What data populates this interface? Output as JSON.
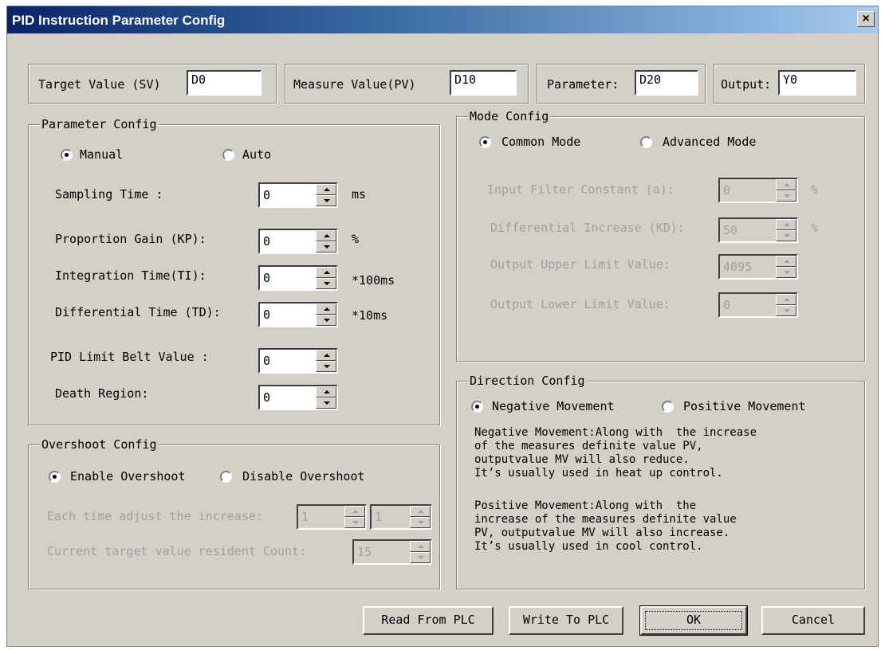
{
  "window": {
    "title": "PID Instruction Parameter Config",
    "close_glyph": "×"
  },
  "top": {
    "target": {
      "label": "Target Value (SV)",
      "value": "D0"
    },
    "measure": {
      "label": "Measure Value(PV)",
      "value": "D10"
    },
    "parameter": {
      "label": "Parameter:",
      "value": "D20"
    },
    "output": {
      "label": "Output:",
      "value": "Y0"
    }
  },
  "param_config": {
    "title": "Parameter Config",
    "manual": "Manual",
    "auto": "Auto",
    "selected": "Manual",
    "rows": [
      {
        "label": "Sampling Time :",
        "value": "0",
        "unit": "ms"
      },
      {
        "label": "Proportion Gain (KP):",
        "value": "0",
        "unit": "%"
      },
      {
        "label": "Integration Time(TI):",
        "value": "0",
        "unit": "*100ms"
      },
      {
        "label": "Differential Time (TD):",
        "value": "0",
        "unit": "*10ms"
      },
      {
        "label": "PID Limit Belt Value :",
        "value": "0",
        "unit": ""
      },
      {
        "label": "Death Region:",
        "value": "0",
        "unit": ""
      }
    ]
  },
  "mode_config": {
    "title": "Mode Config",
    "common": "Common Mode",
    "advanced": "Advanced Mode",
    "selected": "Common Mode",
    "rows": [
      {
        "label": "Input Filter Constant (a):",
        "value": "0",
        "unit": "%"
      },
      {
        "label": "Differential Increase (KD):",
        "value": "50",
        "unit": "%"
      },
      {
        "label": "Output Upper Limit Value:",
        "value": "4095",
        "unit": ""
      },
      {
        "label": "Output Lower Limit Value:",
        "value": "0",
        "unit": ""
      }
    ]
  },
  "overshoot": {
    "title": "Overshoot Config",
    "enable": "Enable Overshoot",
    "disable": "Disable Overshoot",
    "selected": "Enable Overshoot",
    "increase_label": "Each time adjust the increase:",
    "increase_a": "1",
    "increase_b": "1",
    "resident_label": "Current target value resident Count:",
    "resident_value": "15"
  },
  "direction": {
    "title": "Direction Config",
    "negative": "Negative Movement",
    "positive": "Positive Movement",
    "selected": "Negative Movement",
    "negative_desc": "Negative Movement:Along with  the increase\nof the measures definite value PV,\noutputvalue MV will also reduce.\nIt’s usually used in heat up control.",
    "positive_desc": "Positive Movement:Along with  the\nincrease of the measures definite value\nPV, outputvalue MV will also increase.\nIt’s usually used in cool control."
  },
  "buttons": {
    "read": "Read From PLC",
    "write": "Write To PLC",
    "ok": "OK",
    "cancel": "Cancel"
  }
}
